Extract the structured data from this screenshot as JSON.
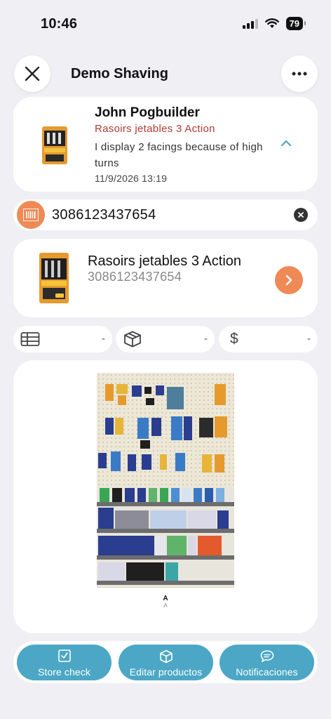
{
  "status_bar": {
    "time": "10:46",
    "battery": "79"
  },
  "header": {
    "title": "Demo Shaving"
  },
  "note": {
    "author": "John Pogbuilder",
    "product": "Rasoirs jetables 3 Action",
    "text": "I display 2 facings because of high turns",
    "date": "11/9/2026 13:19"
  },
  "search": {
    "value": "3086123437654"
  },
  "product": {
    "name": "Rasoirs jetables 3 Action",
    "ean": "3086123437654"
  },
  "metrics": [
    {
      "icon": "grid-icon",
      "value": "-"
    },
    {
      "icon": "box-icon",
      "value": "-"
    },
    {
      "icon": "dollar-icon",
      "symbol": "$",
      "value": "-"
    }
  ],
  "planogram": {
    "section": "A",
    "section_sub": "A"
  },
  "actions": [
    {
      "label": "Store check",
      "icon": "checkbox-icon"
    },
    {
      "label": "Editar productos",
      "icon": "cube-icon"
    },
    {
      "label": "Notificaciones",
      "icon": "chat-bubble-icon"
    }
  ],
  "colors": {
    "accent_orange": "#ee8a56",
    "accent_blue": "#4ba7c5",
    "note_product_red": "#b03a32",
    "background": "#efeff4"
  }
}
